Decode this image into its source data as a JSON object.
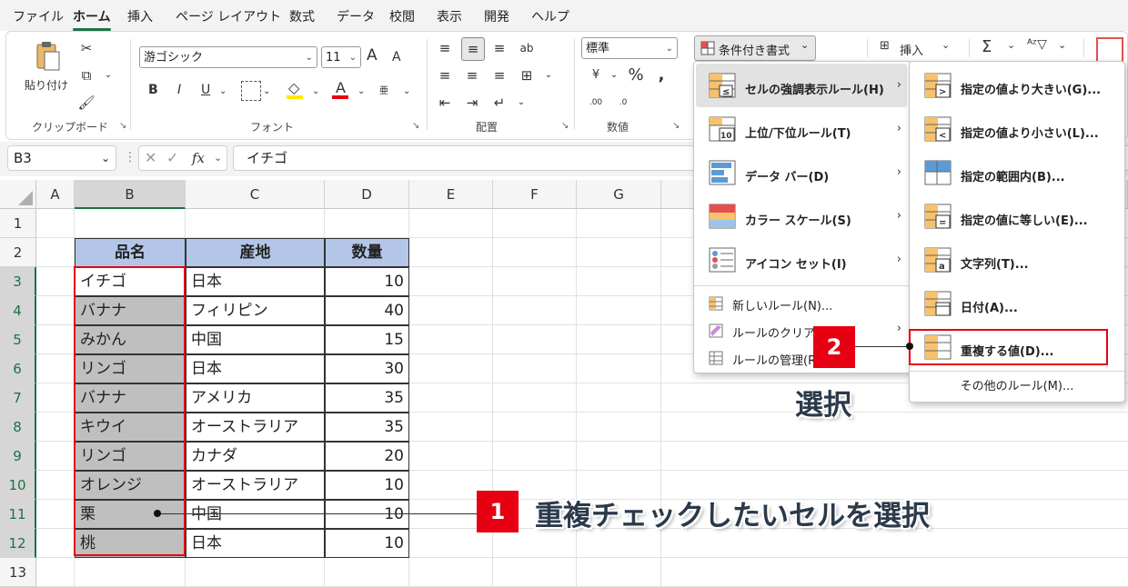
{
  "menu_tabs": [
    "ファイル",
    "ホーム",
    "挿入",
    "ページ レイアウト",
    "数式",
    "データ",
    "校閲",
    "表示",
    "開発",
    "ヘルプ"
  ],
  "ribbon": {
    "paste_label": "貼り付け",
    "clipboard_label": "クリップボード",
    "font_name": "游ゴシック",
    "font_size": "11",
    "font_label": "フォント",
    "align_label": "配置",
    "number_format": "標準",
    "number_label": "数値",
    "cond_format_label": "条件付き書式",
    "insert_label": "挿入",
    "bold": "B",
    "italic": "I",
    "underline": "U",
    "font_color": "A",
    "grow": "A",
    "shrink": "A"
  },
  "formula_bar": {
    "name_box": "B3",
    "fx": "fx",
    "content": "イチゴ"
  },
  "columns": [
    "A",
    "B",
    "C",
    "D",
    "E",
    "F",
    "G"
  ],
  "rows": [
    "1",
    "2",
    "3",
    "4",
    "5",
    "6",
    "7",
    "8",
    "9",
    "10",
    "11",
    "12",
    "13"
  ],
  "table": {
    "headers": [
      "品名",
      "産地",
      "数量"
    ],
    "rows": [
      [
        "イチゴ",
        "日本",
        "10"
      ],
      [
        "バナナ",
        "フィリピン",
        "40"
      ],
      [
        "みかん",
        "中国",
        "15"
      ],
      [
        "リンゴ",
        "日本",
        "30"
      ],
      [
        "バナナ",
        "アメリカ",
        "35"
      ],
      [
        "キウイ",
        "オーストラリア",
        "35"
      ],
      [
        "リンゴ",
        "カナダ",
        "20"
      ],
      [
        "オレンジ",
        "オーストラリア",
        "10"
      ],
      [
        "栗",
        "中国",
        "10"
      ],
      [
        "桃",
        "日本",
        "10"
      ]
    ]
  },
  "cond_menu": {
    "items": [
      "セルの強調表示ルール(H)",
      "上位/下位ルール(T)",
      "データ バー(D)",
      "カラー スケール(S)",
      "アイコン セット(I)"
    ],
    "new_rule": "新しいルール(N)...",
    "clear_rule": "ルールのクリア(C)",
    "manage_rule": "ルールの管理(R)..."
  },
  "submenu": {
    "items": [
      "指定の値より大きい(G)...",
      "指定の値より小さい(L)...",
      "指定の範囲内(B)...",
      "指定の値に等しい(E)...",
      "文字列(T)...",
      "日付(A)...",
      "重複する値(D)..."
    ],
    "other": "その他のルール(M)..."
  },
  "annotations": {
    "step1_num": "1",
    "step1_text": "重複チェックしたいセルを選択",
    "step2_num": "2",
    "step2_text": "選択"
  },
  "colors": {
    "accent": "#1e7145",
    "header_fill": "#b4c6e7",
    "selection": "#bfbfbf",
    "callout": "#e60012"
  }
}
